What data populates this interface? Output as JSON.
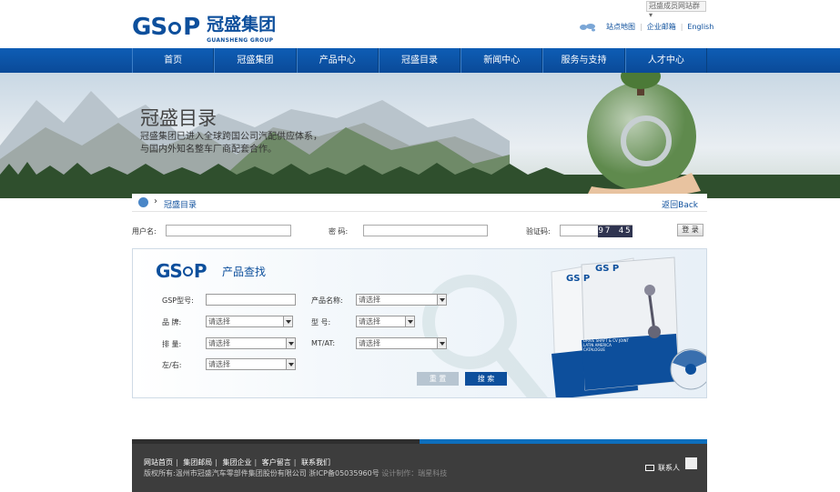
{
  "header": {
    "brand_mark": "GS P",
    "brand_cn": "冠盛集团",
    "brand_en": "GUANSHENG GROUP",
    "site_select": "冠盛成员网站群",
    "links": [
      "站点地图",
      "企业邮箱",
      "English"
    ]
  },
  "nav": {
    "items": [
      "首页",
      "冠盛集团",
      "产品中心",
      "冠盛目录",
      "新闻中心",
      "服务与支持",
      "人才中心"
    ]
  },
  "banner": {
    "title": "冠盛目录",
    "desc_line1": "冠盛集团已进入全球跨国公司汽配供应体系，",
    "desc_line2": "与国内外知名整车厂商配套合作。"
  },
  "breadcrumb": {
    "current": "冠盛目录",
    "back": "返回Back"
  },
  "login": {
    "username_label": "用户名:",
    "password_label": "密    码:",
    "captcha_label": "验证码:",
    "captcha_value": "97 45",
    "submit": "登 录"
  },
  "search": {
    "logo": "GS P",
    "title": "产品查找",
    "gsp_label": "GSP型号:",
    "product_label": "产品名称:",
    "brand_label": "品    牌:",
    "model_label": "型    号:",
    "displacement_label": "排    量:",
    "mtat_label": "MT/AT:",
    "side_label": "左/右:",
    "placeholder": "请选择",
    "reset": "重 置",
    "submit": "搜 索",
    "catalog_brand": "GS P",
    "catalog_title1": "DRIVE SHAFT & CV JOINT",
    "catalog_title2": "LATIN AMERICA",
    "catalog_title3": "CATALOGUE"
  },
  "footer": {
    "links": [
      "网站首页",
      "集团邮局",
      "集团企业",
      "客户留言",
      "联系我们"
    ],
    "copyright": "版权所有:温州市冠盛汽车零部件集团股份有限公司 浙ICP备05035960号",
    "credit": "设计制作：瑞星科技",
    "contact": "联系人"
  }
}
